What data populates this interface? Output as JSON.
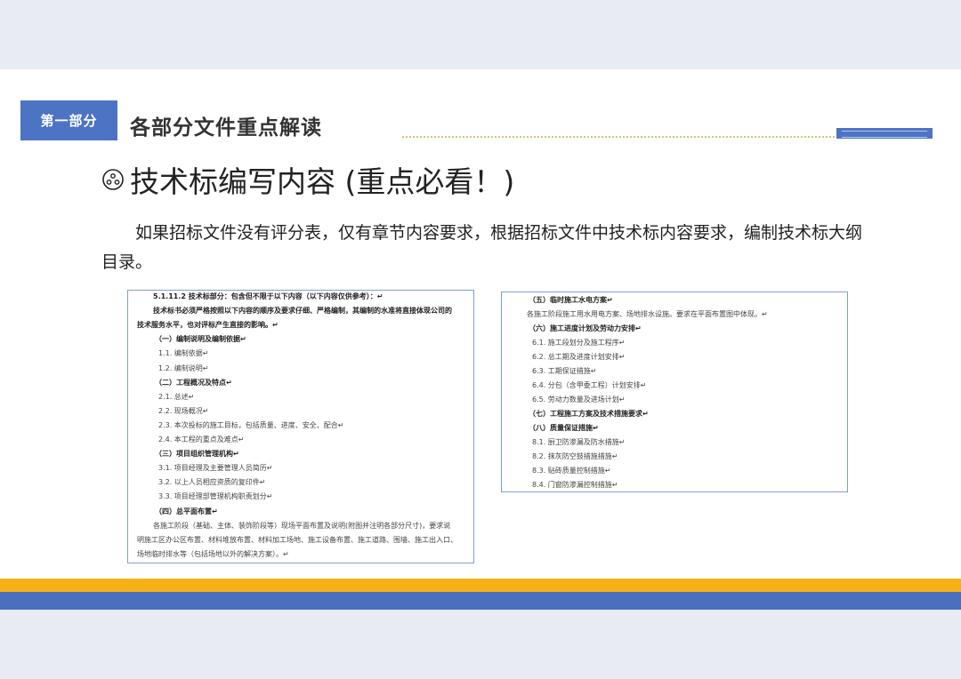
{
  "section": {
    "tag": "第一部分",
    "title": "各部分文件重点解读"
  },
  "heading": "技术标编写内容 (重点必看！)",
  "body": "如果招标文件没有评分表，仅有章节内容要求，根据招标文件中技术标内容要求，编制技术标大纲目录。",
  "doc_left": [
    {
      "text": "5.1.11.2  技术标部分：包含但不限于以下内容（以下内容仅供参考）：↵",
      "bold": true,
      "indent": 28
    },
    {
      "text": "技术标书必须严格按照以下内容的顺序及要求仔细、严格编制，其编制的水准将直接体现公司的",
      "bold": true,
      "indent": 28
    },
    {
      "text": "技术服务水平，也对评标产生直接的影响。↵",
      "bold": true,
      "indent": 10
    },
    {
      "text": "（一）编制说明及编制依据↵",
      "bold": true,
      "indent": 30
    },
    {
      "text": "1.1.  编制依据↵",
      "bold": false,
      "indent": 34
    },
    {
      "text": "1.2.  编制说明↵",
      "bold": false,
      "indent": 34
    },
    {
      "text": "（二）工程概况及特点↵",
      "bold": true,
      "indent": 30
    },
    {
      "text": "2.1.  总述↵",
      "bold": false,
      "indent": 34
    },
    {
      "text": "2.2.  现场概况↵",
      "bold": false,
      "indent": 34
    },
    {
      "text": "2.3.  本次投标的施工目标，包括质量、进度、安全、配合↵",
      "bold": false,
      "indent": 34
    },
    {
      "text": "2.4.  本工程的重点及难点↵",
      "bold": false,
      "indent": 34
    },
    {
      "text": "（三）项目组织管理机构↵",
      "bold": true,
      "indent": 30
    },
    {
      "text": "3.1.  项目经理及主要管理人员简历↵",
      "bold": false,
      "indent": 34
    },
    {
      "text": "3.2.  以上人员相应资质的复印件↵",
      "bold": false,
      "indent": 34
    },
    {
      "text": "3.3.  项目经理部管理机构职责划分↵",
      "bold": false,
      "indent": 34
    },
    {
      "text": "（四）总平面布置↵",
      "bold": true,
      "indent": 30
    },
    {
      "text": "各施工阶段（基础、主体、装饰阶段等）现场平面布置及说明(附图并注明各部分尺寸)，要求说",
      "bold": false,
      "indent": 28
    },
    {
      "text": "明施工区办公区布置、材料堆放布置、材料加工场地、施工设备布置、施工道路、围墙、施工出入口、",
      "bold": false,
      "indent": 10
    },
    {
      "text": "场地临时排水等（包括场地以外的解决方案）。↵",
      "bold": false,
      "indent": 10
    }
  ],
  "doc_right": [
    {
      "text": "（五）临时施工水电方案↵",
      "bold": true,
      "indent": 30
    },
    {
      "text": "各施工阶段施工用水用电方案、场地排水设施。要求在平面布置图中体现。↵",
      "bold": false,
      "indent": 28
    },
    {
      "text": "（六）施工进度计划及劳动力安排↵",
      "bold": true,
      "indent": 30
    },
    {
      "text": "6.1.  施工段划分及施工程序↵",
      "bold": false,
      "indent": 34
    },
    {
      "text": "6.2.  总工期及进度计划安排↵",
      "bold": false,
      "indent": 34
    },
    {
      "text": "6.3.  工期保证措施↵",
      "bold": false,
      "indent": 34
    },
    {
      "text": "6.4.  分包（含甲委工程）计划安排↵",
      "bold": false,
      "indent": 34
    },
    {
      "text": "6.5.  劳动力数量及进场计划↵",
      "bold": false,
      "indent": 34
    },
    {
      "text": "（七）工程施工方案及技术措施要求↵",
      "bold": true,
      "indent": 30
    },
    {
      "text": "（八）质量保证措施↵",
      "bold": true,
      "indent": 30
    },
    {
      "text": "8.1.  厨卫防渗漏及防水措施↵",
      "bold": false,
      "indent": 34
    },
    {
      "text": "8.2.  抹灰防空鼓措施措施↵",
      "bold": false,
      "indent": 34
    },
    {
      "text": "8.3.  贴砖质量控制措施↵",
      "bold": false,
      "indent": 34
    },
    {
      "text": "8.4.  门窗防渗漏控制措施↵",
      "bold": false,
      "indent": 34
    }
  ],
  "icons": {
    "heading_bullet": "circled-bullet-icon"
  },
  "colors": {
    "accent_blue": "#4d74c4",
    "bar_orange": "#f5b116",
    "bar_blue": "#4a6fbf"
  }
}
